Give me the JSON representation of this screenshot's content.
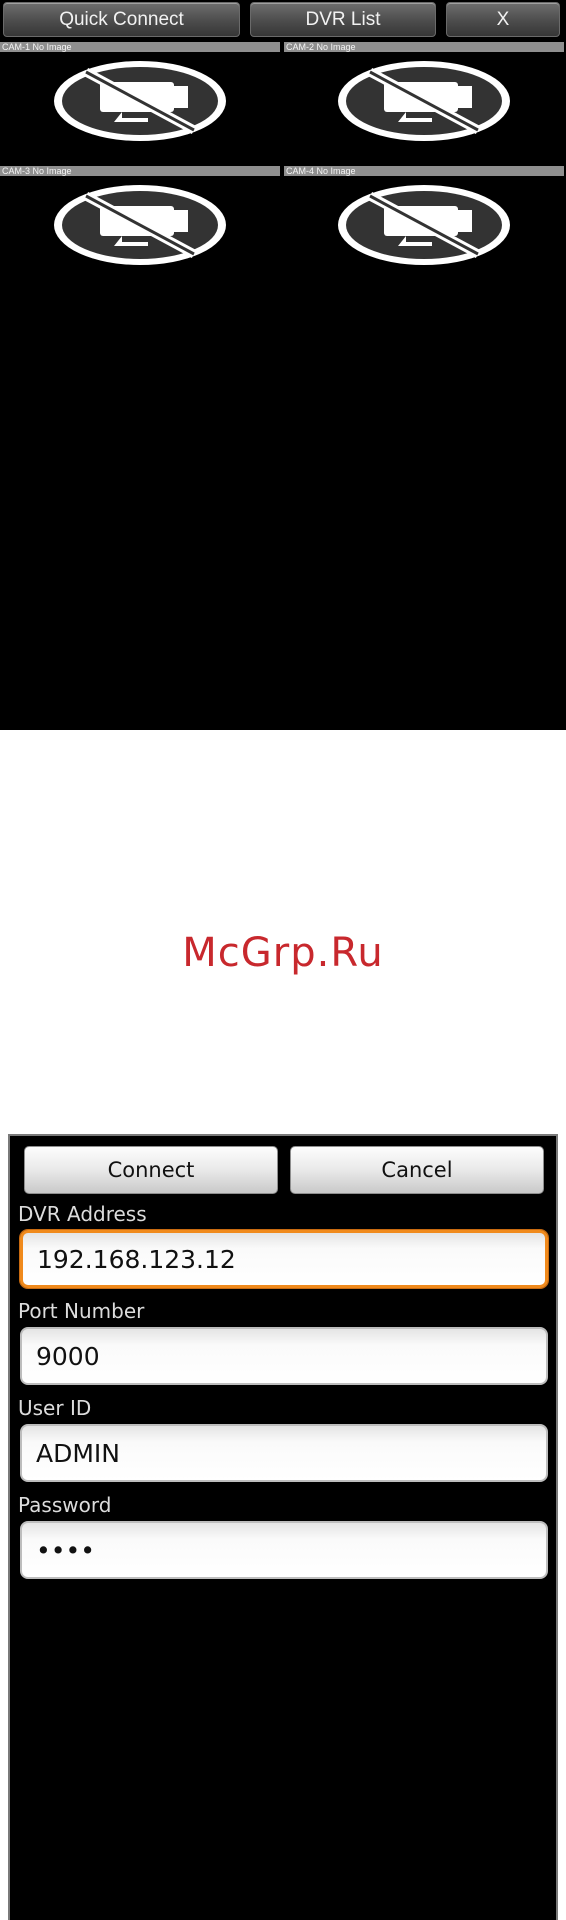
{
  "top_screen": {
    "toolbar": {
      "quick_connect_label": "Quick Connect",
      "dvr_list_label": "DVR List",
      "close_label": "X"
    },
    "cameras": [
      {
        "label": "CAM-1 No Image"
      },
      {
        "label": "CAM-2 No Image"
      },
      {
        "label": "CAM-3 No Image"
      },
      {
        "label": "CAM-4 No Image"
      }
    ],
    "no_image_icon": "no-camera-icon"
  },
  "watermark": "McGrp.Ru",
  "quick_connect_form": {
    "connect_label": "Connect",
    "cancel_label": "Cancel",
    "fields": {
      "dvr_address": {
        "label": "DVR Address",
        "value": "192.168.123.12"
      },
      "port_number": {
        "label": "Port Number",
        "value": "9000"
      },
      "user_id": {
        "label": "User ID",
        "value": "ADMIN"
      },
      "password": {
        "label": "Password",
        "value": "••••"
      }
    }
  },
  "colors": {
    "focus_border": "#f08a1c",
    "watermark": "#c8282d",
    "background": "#000000"
  }
}
